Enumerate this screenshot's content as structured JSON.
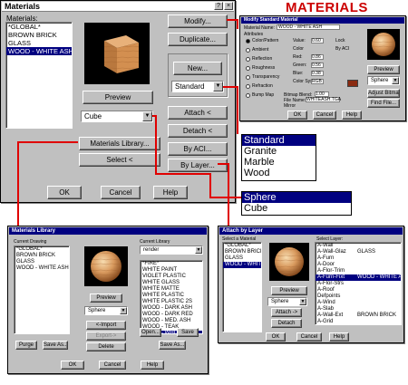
{
  "header_title": "MATERIALS",
  "materials_dialog": {
    "title": "Materials",
    "materials_label": "Materials:",
    "materials": [
      "*GLOBAL*",
      "BROWN BRICK",
      "GLASS",
      "WOOD - WHITE ASH"
    ],
    "selected_index": 3,
    "preview_button": "Preview",
    "preview_shape": "Cube",
    "buttons": {
      "modify": "Modify...",
      "duplicate": "Duplicate...",
      "new": "New...",
      "attach": "Attach <",
      "detach": "Detach <",
      "by_aci": "By ACI...",
      "by_layer": "By Layer...",
      "materials_library": "Materials Library...",
      "select": "Select <",
      "ok": "OK",
      "cancel": "Cancel",
      "help": "Help"
    },
    "new_type": "Standard"
  },
  "type_dropdown": {
    "options": [
      "Standard",
      "Granite",
      "Marble",
      "Wood"
    ],
    "selected_index": 0
  },
  "shape_dropdown": {
    "options": [
      "Sphere",
      "Cube"
    ],
    "selected_index": 0
  },
  "modify_dialog": {
    "title": "Modify Standard Material",
    "material_name_label": "Material Name:",
    "material_name": "WOOD - WHITE ASH",
    "attributes_label": "Attributes",
    "attributes": [
      "Color/Pattern",
      "Ambient",
      "Reflection",
      "Roughness",
      "Transparency",
      "Refraction",
      "Bump Map"
    ],
    "fields": [
      {
        "label": "Value:",
        "value": "0.60"
      },
      {
        "label": "Color",
        "value": ""
      },
      {
        "label": "Red:",
        "value": "0.86"
      },
      {
        "label": "Green:",
        "value": "0.56"
      },
      {
        "label": "Blue:",
        "value": "0.38"
      },
      {
        "label": "Color System:",
        "value": "RGB"
      }
    ],
    "by_aci": "By ACI",
    "lock": "Lock",
    "mirror": "Mirror",
    "bitmap_blend_label": "Bitmap Blend:",
    "bitmap_blend": "1.00",
    "file_name_label": "File Name:",
    "file_name": "WHITEASH.TGA",
    "preview_button": "Preview",
    "preview_shape": "Sphere",
    "adjust_bitmap": "Adjust Bitmap...",
    "find_file": "Find File...",
    "ok": "OK",
    "cancel": "Cancel",
    "help": "Help"
  },
  "library_dialog": {
    "title": "Materials Library",
    "current_drawing_label": "Current Drawing",
    "current_drawing": [
      "*GLOBAL*",
      "BROWN BRICK",
      "GLASS",
      "WOOD - WHITE ASH"
    ],
    "current_library_label": "Current Library",
    "library_name": "render",
    "current_library": [
      "*FIRE*",
      "WHITE PAINT",
      "VIOLET PLASTIC",
      "WHITE GLASS",
      "WHITE MATTE",
      "WHITE PLASTIC",
      "WHITE PLASTIC 2S",
      "WOOD - DARK ASH",
      "WOOD - DARK RED",
      "WOOD - MED. ASH",
      "WOOD - TEAK",
      "WOOD - WHITE ASH"
    ],
    "library_selected_index": 11,
    "preview_button": "Preview",
    "preview_shape": "Sphere",
    "import": "<-Import",
    "export": "Export->",
    "delete": "Delete",
    "purge": "Purge",
    "save_as_left": "Save As...",
    "open": "Open...",
    "save": "Save",
    "save_as_right": "Save As...",
    "ok": "OK",
    "cancel": "Cancel",
    "help": "Help"
  },
  "bylayer_dialog": {
    "title": "Attach by Layer",
    "select_material_label": "Select a Material",
    "materials": [
      "*GLOBAL*",
      "BROWN BRICK",
      "GLASS",
      "WOOD - WHITE ASH"
    ],
    "materials_selected_index": 3,
    "select_layer_label": "Select Layer:",
    "layers": [
      {
        "name": "A-Wall",
        "material": ""
      },
      {
        "name": "A-Wall-Glaz",
        "material": "GLASS"
      },
      {
        "name": "A-Furn",
        "material": ""
      },
      {
        "name": "A-Door",
        "material": ""
      },
      {
        "name": "A-Flor-Trim",
        "material": ""
      },
      {
        "name": "A-Furn-Fixt",
        "material": "WOOD - WHITE ASH"
      },
      {
        "name": "A-Flor-Strs",
        "material": ""
      },
      {
        "name": "A-Roof",
        "material": ""
      },
      {
        "name": "Defpoints",
        "material": ""
      },
      {
        "name": "A-Wind",
        "material": ""
      },
      {
        "name": "A-Slab",
        "material": ""
      },
      {
        "name": "A-Wall-Ext",
        "material": "BROWN BRICK"
      },
      {
        "name": "A-Grid",
        "material": ""
      },
      {
        "name": "AEHADE",
        "material": ""
      },
      {
        "name": "0",
        "material": ""
      }
    ],
    "layers_selected_index": 5,
    "preview_button": "Preview",
    "preview_shape": "Sphere",
    "attach": "Attach ->",
    "detach": "Detach",
    "ok": "OK",
    "cancel": "Cancel",
    "help": "Help"
  },
  "colors": {
    "accent": "#000080",
    "callout": "#e00000",
    "dialog": "#c0c0c0",
    "header": "#cc0000"
  }
}
